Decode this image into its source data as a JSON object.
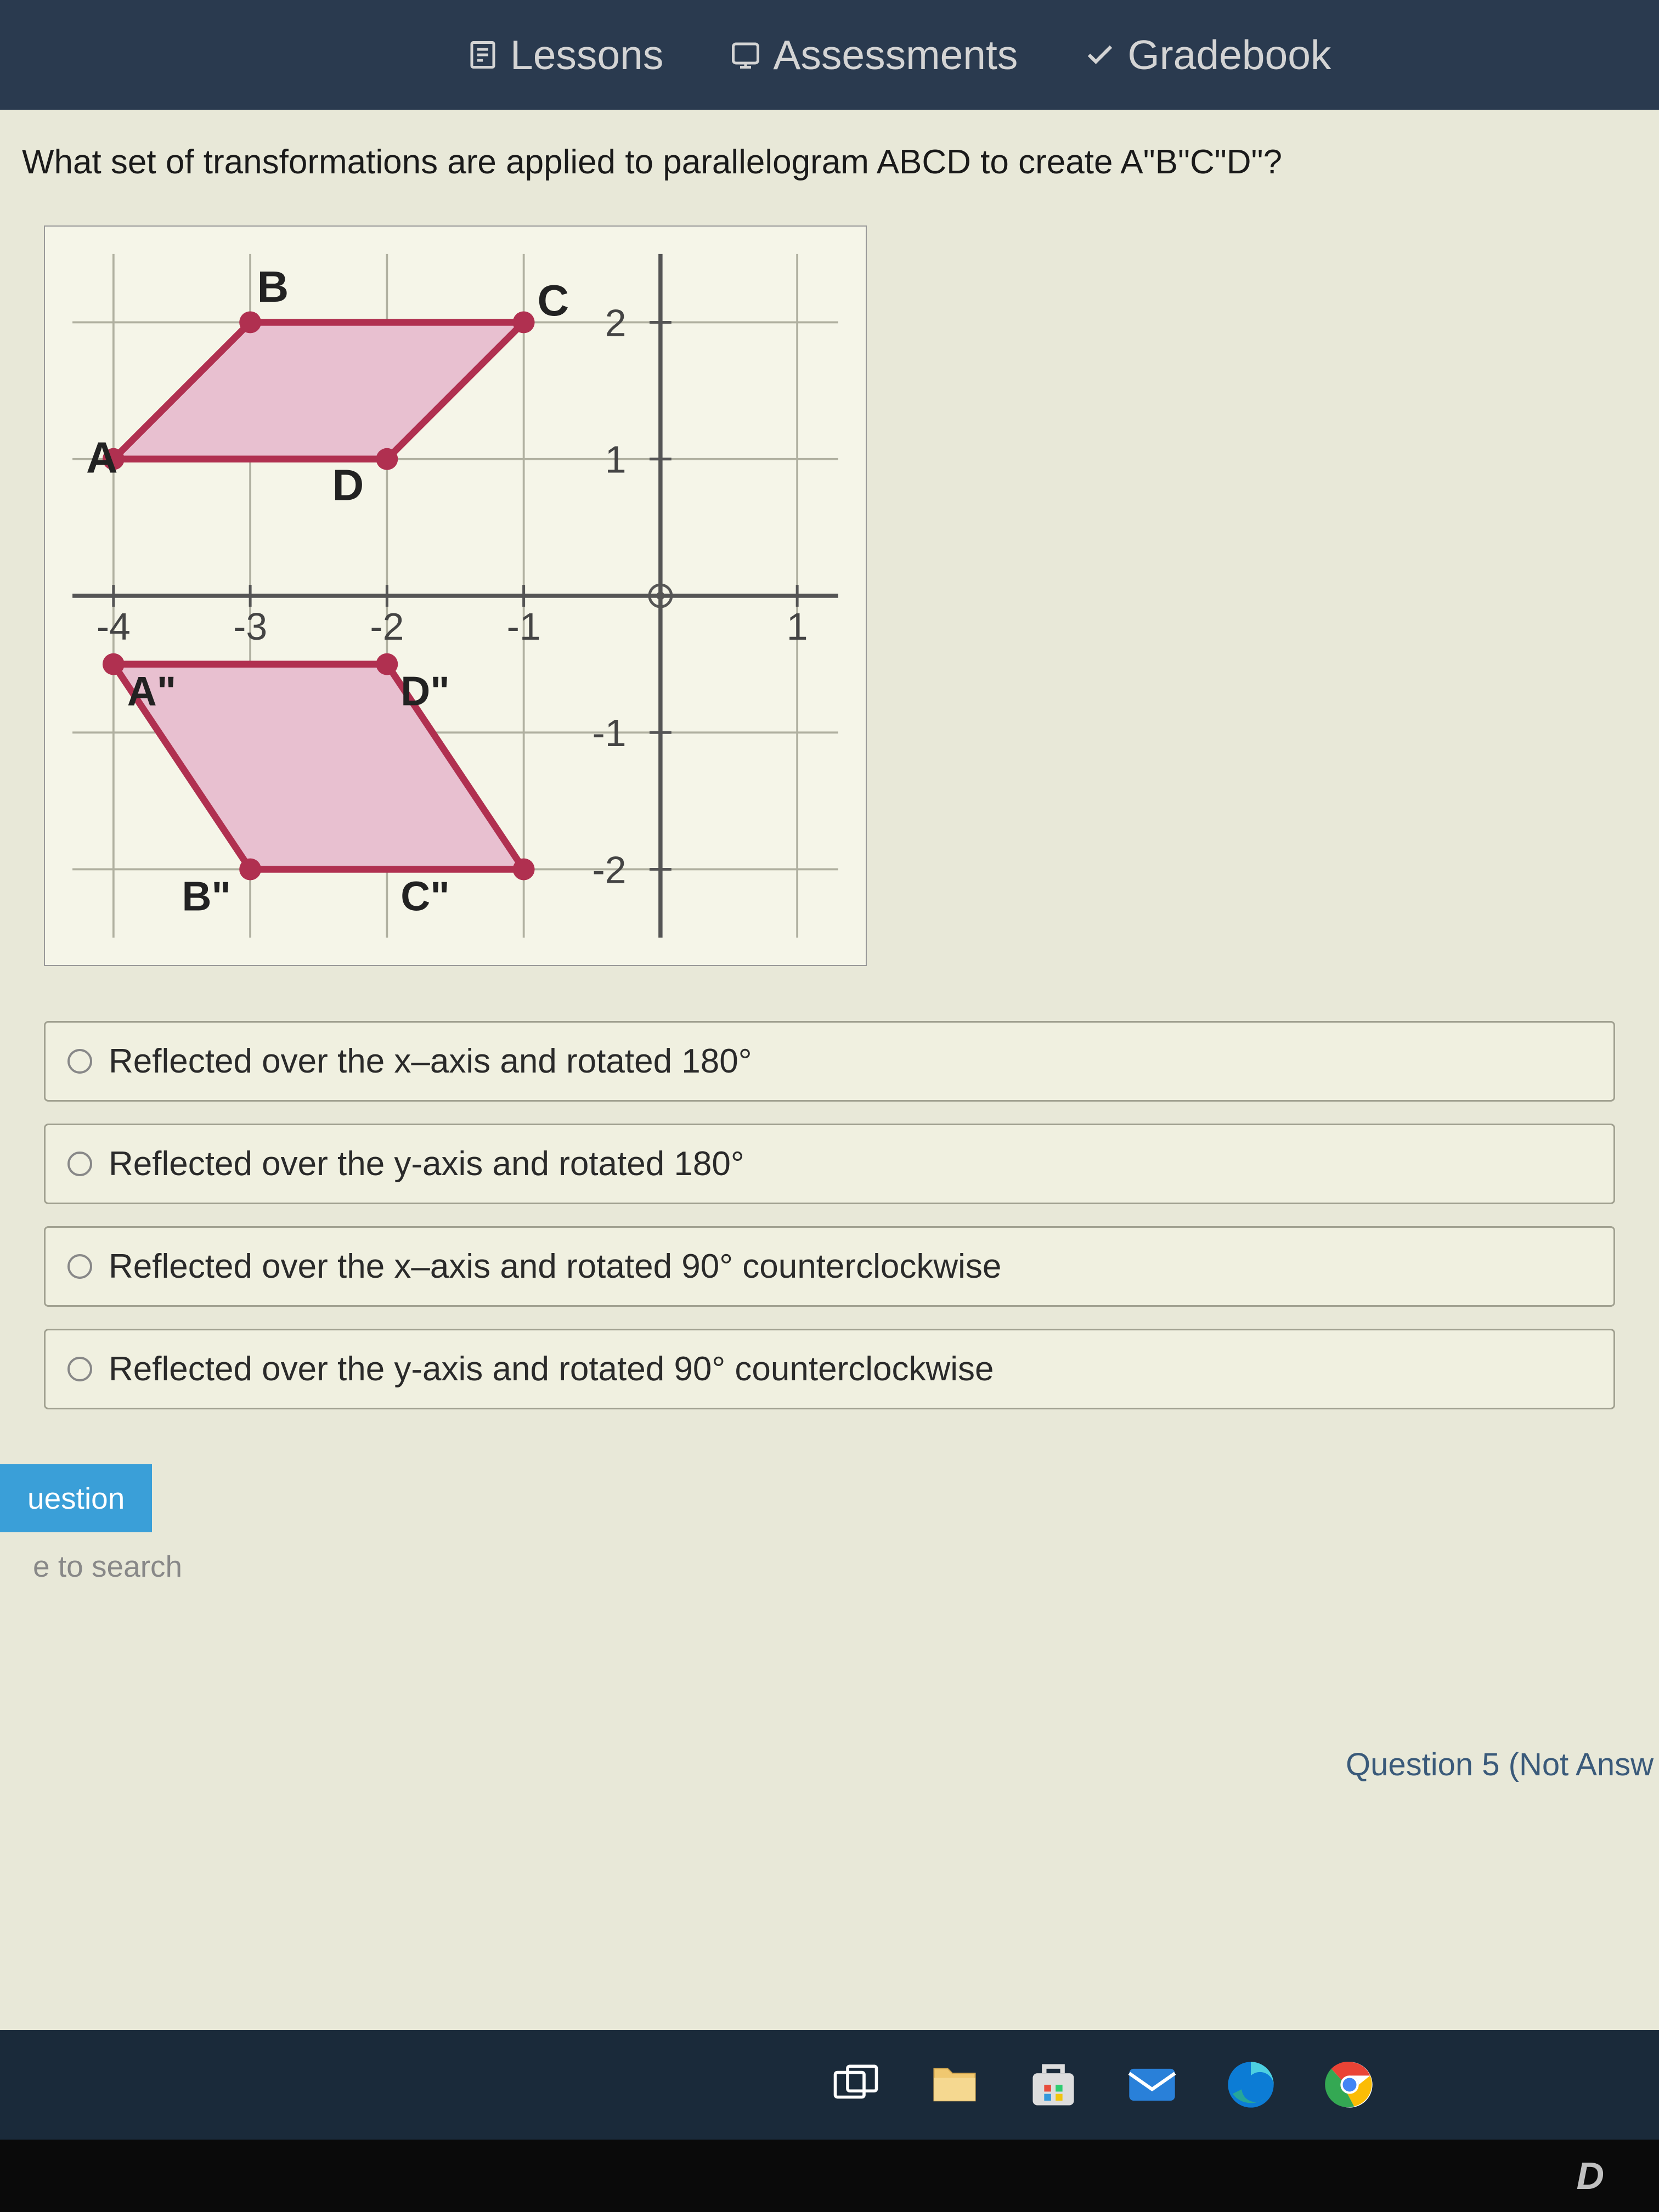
{
  "nav": {
    "lessons": "Lessons",
    "assessments": "Assessments",
    "gradebook": "Gradebook"
  },
  "question": "What set of transformations are applied to parallelogram ABCD to create A\"B\"C\"D\"?",
  "graph": {
    "labels": {
      "A": "A",
      "B": "B",
      "C": "C",
      "D": "D",
      "A2": "A\"",
      "B2": "B\"",
      "C2": "C\"",
      "D2": "D\""
    },
    "axis_labels": {
      "x": [
        "-4",
        "-3",
        "-2",
        "-1",
        "1"
      ],
      "y": [
        "2",
        "1",
        "-1",
        "-2"
      ]
    }
  },
  "answers": [
    "Reflected over the x–axis and rotated 180°",
    "Reflected over the y-axis and rotated 180°",
    "Reflected over the x–axis and rotated 90° counterclockwise",
    "Reflected over the y-axis and rotated 90° counterclockwise"
  ],
  "question_button": "uestion",
  "status": "Question 5 (Not Answ",
  "search": "e to search",
  "dell": "D"
}
